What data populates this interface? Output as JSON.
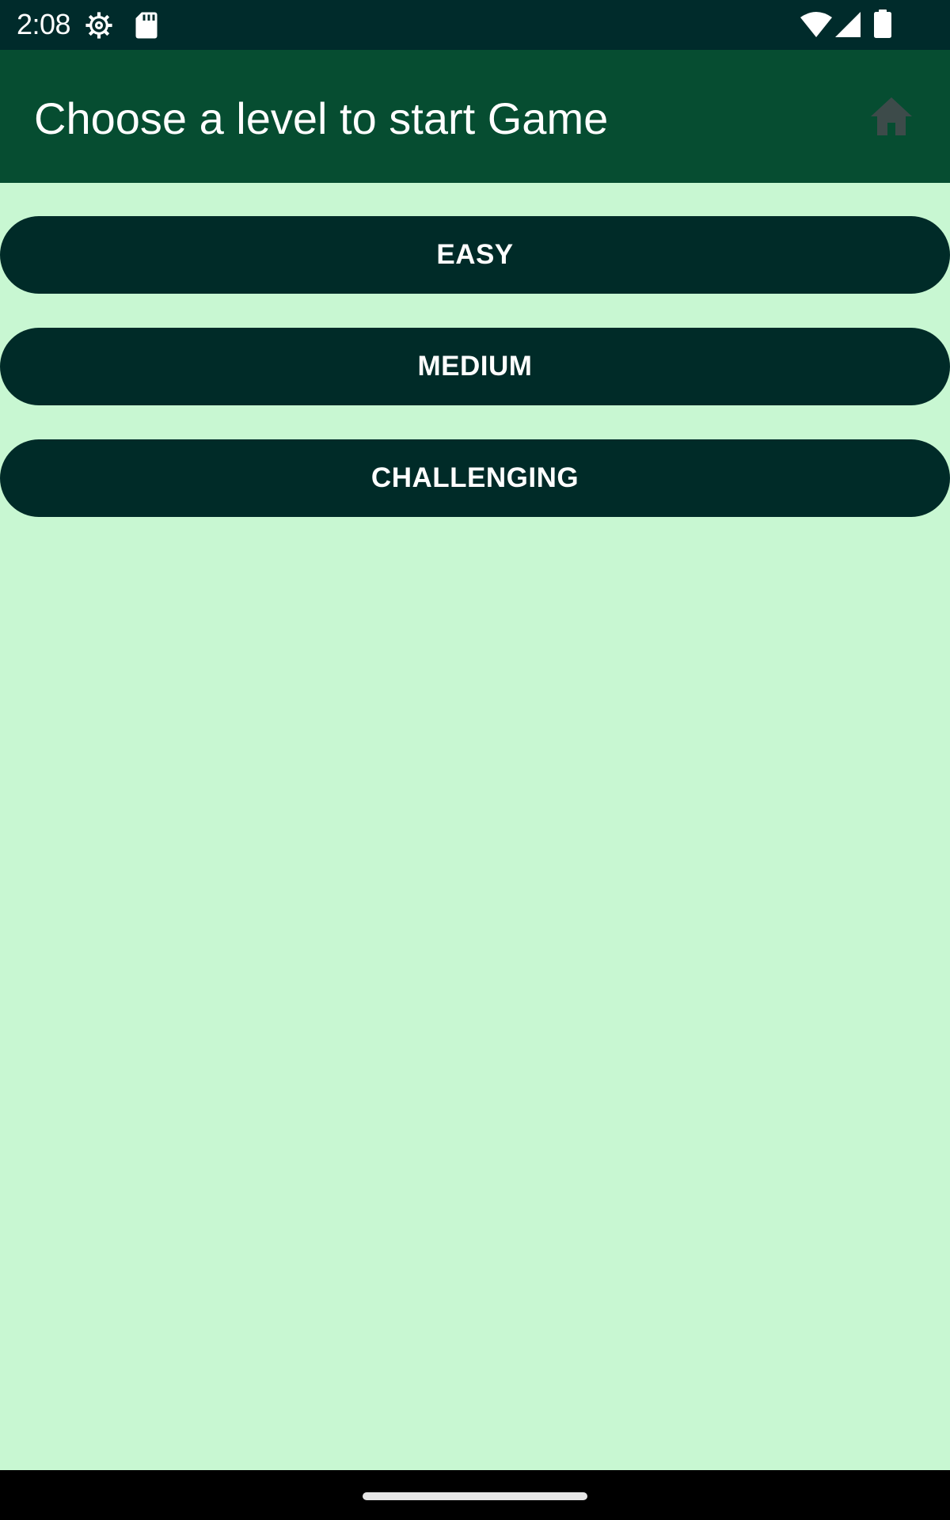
{
  "status_bar": {
    "time": "2:08",
    "icons": [
      "settings-gear-icon",
      "sd-card-icon",
      "wifi-icon",
      "cell-signal-icon",
      "battery-icon"
    ]
  },
  "app_bar": {
    "title": "Choose a level to start Game",
    "home_icon": "home-icon"
  },
  "levels": {
    "easy": "EASY",
    "medium": "MEDIUM",
    "challenging": "CHALLENGING"
  },
  "colors": {
    "status_bar": "#002b2b",
    "app_bar": "#064d31",
    "background": "#c8f7d2",
    "button": "#002b28",
    "button_text": "#ffffff",
    "home_icon": "#3d4b4a"
  }
}
